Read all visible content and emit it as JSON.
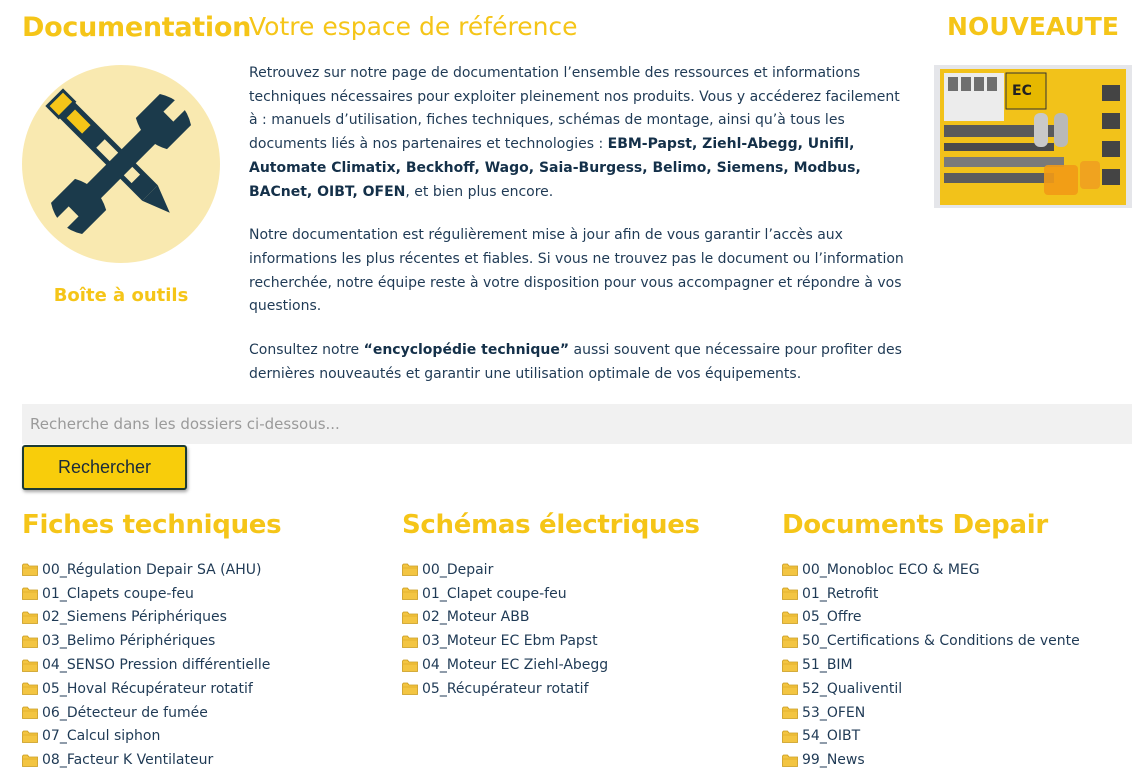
{
  "left": {
    "title": "Documentation",
    "toolbox_label": "Boîte à outils"
  },
  "intro": {
    "subtitle": "Votre espace de référence",
    "p1_text": "Retrouvez sur notre page de documentation l’ensemble des ressources et informations techniques nécessaires pour exploiter pleinement nos produits. Vous y accéderez facilement à : manuels d’utilisation, fiches techniques, schémas de montage, ainsi qu’à tous les documents liés à nos partenaires et technologies : ",
    "p1_brands": "EBM-Papst, Ziehl-Abegg, Unifil, Automate Climatix, Beckhoff, Wago, Saia-Burgess, Belimo, Siemens, Modbus, BACnet, OIBT, OFEN",
    "p1_end": ", et bien plus encore.",
    "p2": "Notre documentation est régulièrement mise à jour afin de vous garantir l’accès aux informations les plus récentes et fiables. Si vous ne trouvez pas le document ou l’information recherchée, notre équipe reste à votre disposition pour vous accompagner et répondre à vos questions.",
    "p3_start": "Consultez notre ",
    "p3_bold": "“encyclopédie technique”",
    "p3_end": " aussi souvent que nécessaire pour profiter des dernières nouveautés et garantir une utilisation optimale de vos équipements."
  },
  "news": {
    "title": "NOUVEAUTE",
    "image_text": "EC"
  },
  "search": {
    "placeholder": "Recherche dans les dossiers ci-dessous...",
    "button_label": "Rechercher"
  },
  "columns": [
    {
      "title": "Fiches techniques",
      "items": [
        "00_Régulation Depair SA (AHU)",
        "01_Clapets coupe-feu",
        "02_Siemens Périphériques",
        "03_Belimo Périphériques",
        "04_SENSO Pression différentielle",
        "05_Hoval Récupérateur rotatif",
        "06_Détecteur de fumée",
        "07_Calcul siphon",
        "08_Facteur K Ventilateur"
      ]
    },
    {
      "title": "Schémas électriques",
      "items": [
        "00_Depair",
        "01_Clapet coupe-feu",
        "02_Moteur ABB",
        "03_Moteur EC Ebm Papst",
        "04_Moteur EC Ziehl-Abegg",
        "05_Récupérateur rotatif"
      ]
    },
    {
      "title": "Documents Depair",
      "items": [
        "00_Monobloc ECO & MEG",
        "01_Retrofit",
        "05_Offre",
        "50_Certifications & Conditions de vente",
        "51_BIM",
        "52_Qualiventil",
        "53_OFEN",
        "54_OIBT",
        "99_News"
      ]
    }
  ],
  "colors": {
    "brand_yellow": "#f5c518",
    "text_navy": "#1f3a55",
    "button_yellow": "#f8cd0b",
    "circle_bg": "#f9e9b0",
    "icon_navy": "#1b3a4b"
  }
}
